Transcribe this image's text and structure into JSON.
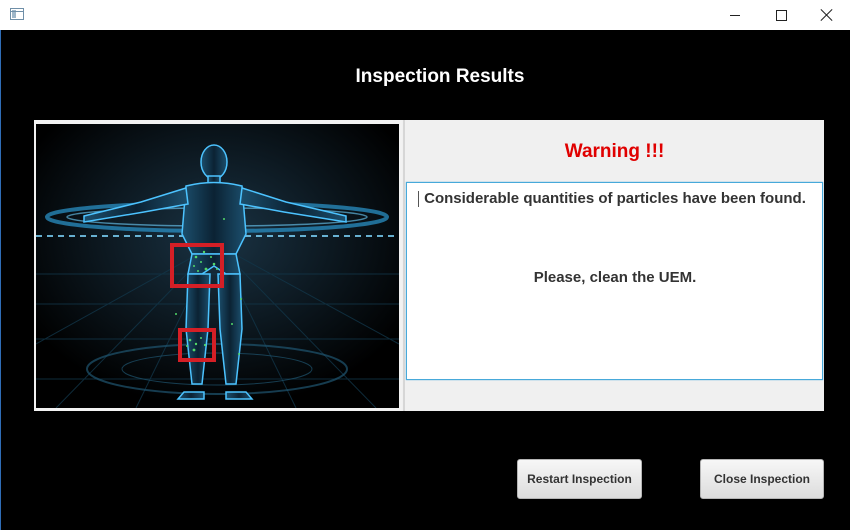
{
  "window": {
    "app_icon": "window-app-icon",
    "controls": [
      "minimize-icon",
      "maximize-icon",
      "close-icon"
    ]
  },
  "header": {
    "title": "Inspection Results"
  },
  "image": {
    "subject": "human-body-scan",
    "detections": 2,
    "marker_color": "#d41f26",
    "particle_color": "#52d86a"
  },
  "result": {
    "warning": "Warning !!!",
    "message_line1": "Considerable quantities of particles have been found.",
    "message_line2": "Please, clean the UEM.",
    "warning_color": "#e00000"
  },
  "actions": {
    "restart_label": "Restart Inspection",
    "close_label": "Close Inspection"
  }
}
